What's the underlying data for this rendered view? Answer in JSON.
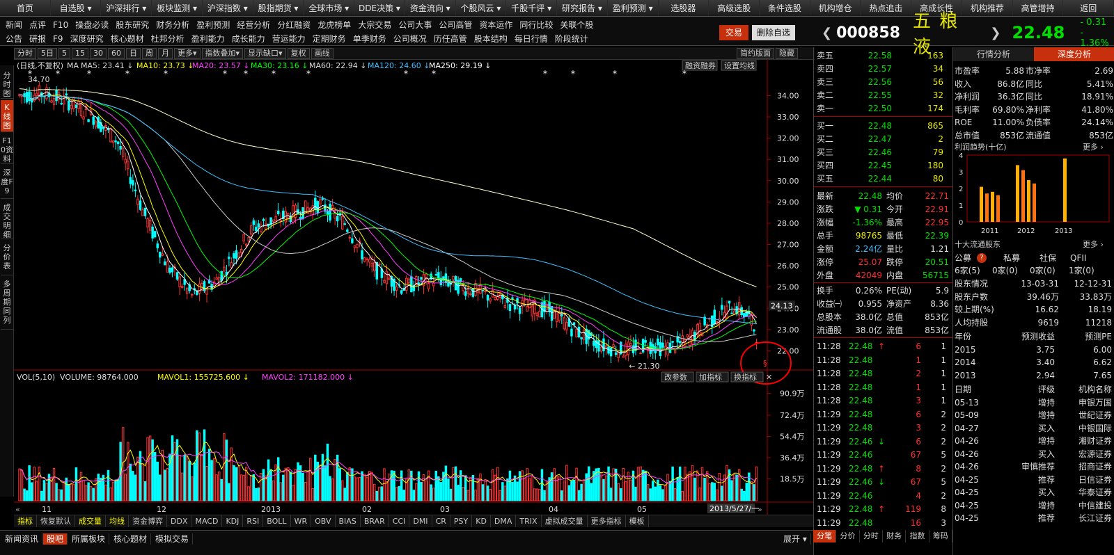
{
  "topnav": [
    "首页",
    "自选股",
    "沪深排行",
    "板块监测",
    "沪深指数",
    "股指期货",
    "全球市场",
    "DDE决策",
    "资金流向",
    "个股风云",
    "千股千评",
    "研究报告",
    "盈利预测",
    "选股器",
    "高级选股",
    "条件选股",
    "机构增仓",
    "热点追击",
    "高成长性",
    "机构推荐",
    "高管增持",
    "返回"
  ],
  "subnav_row1": [
    "新闻",
    "点评",
    "F10",
    "操盘必读",
    "股东研究",
    "财务分析",
    "盈利预测",
    "经营分析",
    "分红融资",
    "龙虎榜单",
    "大宗交易",
    "公司大事",
    "公司高管",
    "资本运作",
    "同行比较",
    "关联个股"
  ],
  "subnav_row2": [
    "公告",
    "研报",
    "F9",
    "深度研究",
    "核心题材",
    "杜邦分析",
    "盈利能力",
    "成长能力",
    "营运能力",
    "定期财务",
    "单季财务",
    "公司概况",
    "历任高管",
    "股本结构",
    "每日行情",
    "阶段统计"
  ],
  "btn_trade": "交易",
  "btn_remove": "删除自选",
  "quote": {
    "code": "000858",
    "name": "五 粮 液",
    "price": "22.48",
    "change": "- 0.31",
    "pct": "- 1.36%"
  },
  "left_tabs": [
    "分时图",
    "K线图",
    "F10资料",
    "深度F9",
    "成交明细",
    "分价表",
    "多周期同列"
  ],
  "toolbar": [
    "分时",
    "5日",
    "5",
    "15",
    "30",
    "60",
    "日",
    "周",
    "月",
    "更多",
    "指数叠加",
    "显示缺口",
    "复权",
    "画线"
  ],
  "toolbar_right": [
    "简约版面",
    "隐藏"
  ],
  "chart": {
    "ma_line": [
      "(日线,不复权)",
      "MA",
      "MA5: 23.41",
      "MA10: 23.73",
      "MA20: 23.57",
      "MA30: 23.16",
      "MA60: 22.94",
      "MA120: 24.60",
      "MA250: 29.19"
    ],
    "btns": [
      "融资融券",
      "设置均线"
    ],
    "vol_line": [
      "VOL(5,10)",
      "VOLUME: 98764.000",
      "MAVOL1: 155725.600",
      "MAVOL2: 171182.000"
    ],
    "vol_btns": [
      "改参数",
      "加指标",
      "换指标"
    ],
    "high_label": "34.70",
    "low_label": "21.30",
    "last_price_label": "24.13",
    "dates": [
      "11",
      "12",
      "2013",
      "02",
      "03",
      "04",
      "05"
    ],
    "cursor_date": "2013/5/27/一",
    "price_ticks": [
      "34.00",
      "33.00",
      "32.00",
      "31.00",
      "30.00",
      "29.00",
      "28.00",
      "27.00",
      "26.00",
      "25.00",
      "24.00",
      "23.00",
      "22.00"
    ],
    "vol_ticks": [
      "90.9万",
      "72.4万",
      "54.4万",
      "36.4万",
      "18.5万"
    ]
  },
  "bottom_tabs": [
    "指标",
    "恢复默认",
    "成交量",
    "均线",
    "资金博弈",
    "DDX",
    "MACD",
    "KDJ",
    "RSI",
    "BOLL",
    "WR",
    "OBV",
    "BIAS",
    "BRAR",
    "CCI",
    "DMI",
    "CR",
    "PSY",
    "KD",
    "DMA",
    "TRIX",
    "虚拟成交量",
    "更多指标",
    "模板"
  ],
  "status": [
    "新闻资讯",
    "股吧",
    "所属板块",
    "核心题材",
    "模拟交易"
  ],
  "status_right": "展开",
  "orderbook": {
    "sell": [
      [
        "卖五",
        "22.58",
        "163"
      ],
      [
        "卖四",
        "22.57",
        "34"
      ],
      [
        "卖三",
        "22.56",
        "56"
      ],
      [
        "卖二",
        "22.55",
        "32"
      ],
      [
        "卖一",
        "22.50",
        "174"
      ]
    ],
    "buy": [
      [
        "买一",
        "22.48",
        "865"
      ],
      [
        "买二",
        "22.47",
        "2"
      ],
      [
        "买三",
        "22.46",
        "79"
      ],
      [
        "买四",
        "22.45",
        "180"
      ],
      [
        "买五",
        "22.44",
        "80"
      ]
    ]
  },
  "stats": [
    [
      "最新",
      "22.48",
      "均价",
      "22.71"
    ],
    [
      "涨跌",
      "▼ 0.31",
      "今开",
      "22.91"
    ],
    [
      "涨幅",
      "-1.36%",
      "最高",
      "22.95"
    ],
    [
      "总手",
      "98765",
      "最低",
      "22.39"
    ],
    [
      "金额",
      "2.24亿",
      "量比",
      "1.21"
    ],
    [
      "涨停",
      "25.07",
      "跌停",
      "20.51"
    ],
    [
      "外盘",
      "42049",
      "内盘",
      "56715"
    ],
    [
      "换手",
      "0.26%",
      "PE(动)",
      "5.9"
    ],
    [
      "收益㈠",
      "0.955",
      "净资产",
      "8.36"
    ],
    [
      "总股本",
      "38.0亿",
      "总值",
      "853亿"
    ],
    [
      "流通股",
      "38.0亿",
      "流值",
      "853亿"
    ]
  ],
  "ticks": [
    [
      "11:28",
      "22.48",
      "↑",
      "6",
      "1"
    ],
    [
      "11:28",
      "22.48",
      "",
      "1",
      "1"
    ],
    [
      "11:28",
      "22.48",
      "",
      "2",
      "1"
    ],
    [
      "11:28",
      "22.48",
      "",
      "1",
      "1"
    ],
    [
      "11:28",
      "22.48",
      "",
      "3",
      "1"
    ],
    [
      "11:29",
      "22.48",
      "",
      "6",
      "2"
    ],
    [
      "11:29",
      "22.48",
      "",
      "3",
      "2"
    ],
    [
      "11:29",
      "22.46",
      "↓",
      "6",
      "2"
    ],
    [
      "11:29",
      "22.46",
      "",
      "67",
      "5"
    ],
    [
      "11:29",
      "22.48",
      "↑",
      "8",
      "2"
    ],
    [
      "11:29",
      "22.46",
      "↓",
      "67",
      "5"
    ],
    [
      "11:29",
      "22.46",
      "",
      "4",
      "2"
    ],
    [
      "11:29",
      "22.48",
      "↑",
      "119",
      "8"
    ],
    [
      "11:29",
      "22.48",
      "",
      "16",
      "3"
    ]
  ],
  "right_tabs": [
    "分笔",
    "分价",
    "分时",
    "财务",
    "指数",
    "筹码"
  ],
  "far": {
    "tabs": [
      "行情分析",
      "深度分析"
    ],
    "fin": [
      [
        "市盈率",
        "5.88",
        "市净率",
        "2.69"
      ],
      [
        "收入",
        "86.8亿",
        "同比",
        "5.41%"
      ],
      [
        "净利润",
        "36.3亿",
        "同比",
        "18.91%"
      ],
      [
        "毛利率",
        "69.80%",
        "净利率",
        "41.80%"
      ],
      [
        "ROE",
        "11.00%",
        "负债率",
        "24.14%"
      ],
      [
        "总市值",
        "853亿",
        "流通值",
        "853亿"
      ]
    ],
    "profit_title": "利润趋势(十亿)",
    "more": "更多",
    "profit_years": [
      "2011",
      "2012",
      "2013"
    ],
    "profit_ticks": [
      "4",
      "3",
      "2",
      "1",
      "0"
    ],
    "profit_values": [
      2.1,
      1.7,
      1.8,
      1.6,
      3.4,
      3.1,
      2.5,
      2.3,
      3.8
    ],
    "holders_title": "十大流通股东",
    "holder_types": [
      "公募",
      "私募",
      "社保",
      "QFII"
    ],
    "holder_counts": [
      "6家(5)",
      "0家(0)",
      "0家(0)",
      "1家(0)"
    ],
    "holder_info": [
      [
        "股东情况",
        "13-03-31",
        "12-12-31"
      ],
      [
        "股东户数",
        "39.46万",
        "33.83万"
      ],
      [
        "较上期(%)",
        "16.62",
        "18.19"
      ],
      [
        "人均持股",
        "9619",
        "11218"
      ]
    ],
    "forecast_head": [
      "年份",
      "预测收益",
      "预测PE"
    ],
    "forecast": [
      [
        "2015",
        "3.75",
        "6.00"
      ],
      [
        "2014",
        "3.40",
        "6.62"
      ],
      [
        "2013",
        "2.94",
        "7.65"
      ]
    ],
    "rating_head": [
      "日期",
      "评级",
      "机构名称"
    ],
    "ratings": [
      [
        "05-13",
        "增持",
        "申银万国"
      ],
      [
        "05-09",
        "增持",
        "世纪证券"
      ],
      [
        "04-27",
        "买入",
        "中银国际"
      ],
      [
        "04-26",
        "增持",
        "湘财证券"
      ],
      [
        "04-26",
        "买入",
        "宏源证券"
      ],
      [
        "04-26",
        "审慎推荐",
        "招商证券"
      ],
      [
        "04-25",
        "推荐",
        "日信证券"
      ],
      [
        "04-25",
        "买入",
        "华泰证券"
      ],
      [
        "04-25",
        "增持",
        "中信建投"
      ],
      [
        "04-25",
        "推荐",
        "长江证券"
      ]
    ]
  }
}
